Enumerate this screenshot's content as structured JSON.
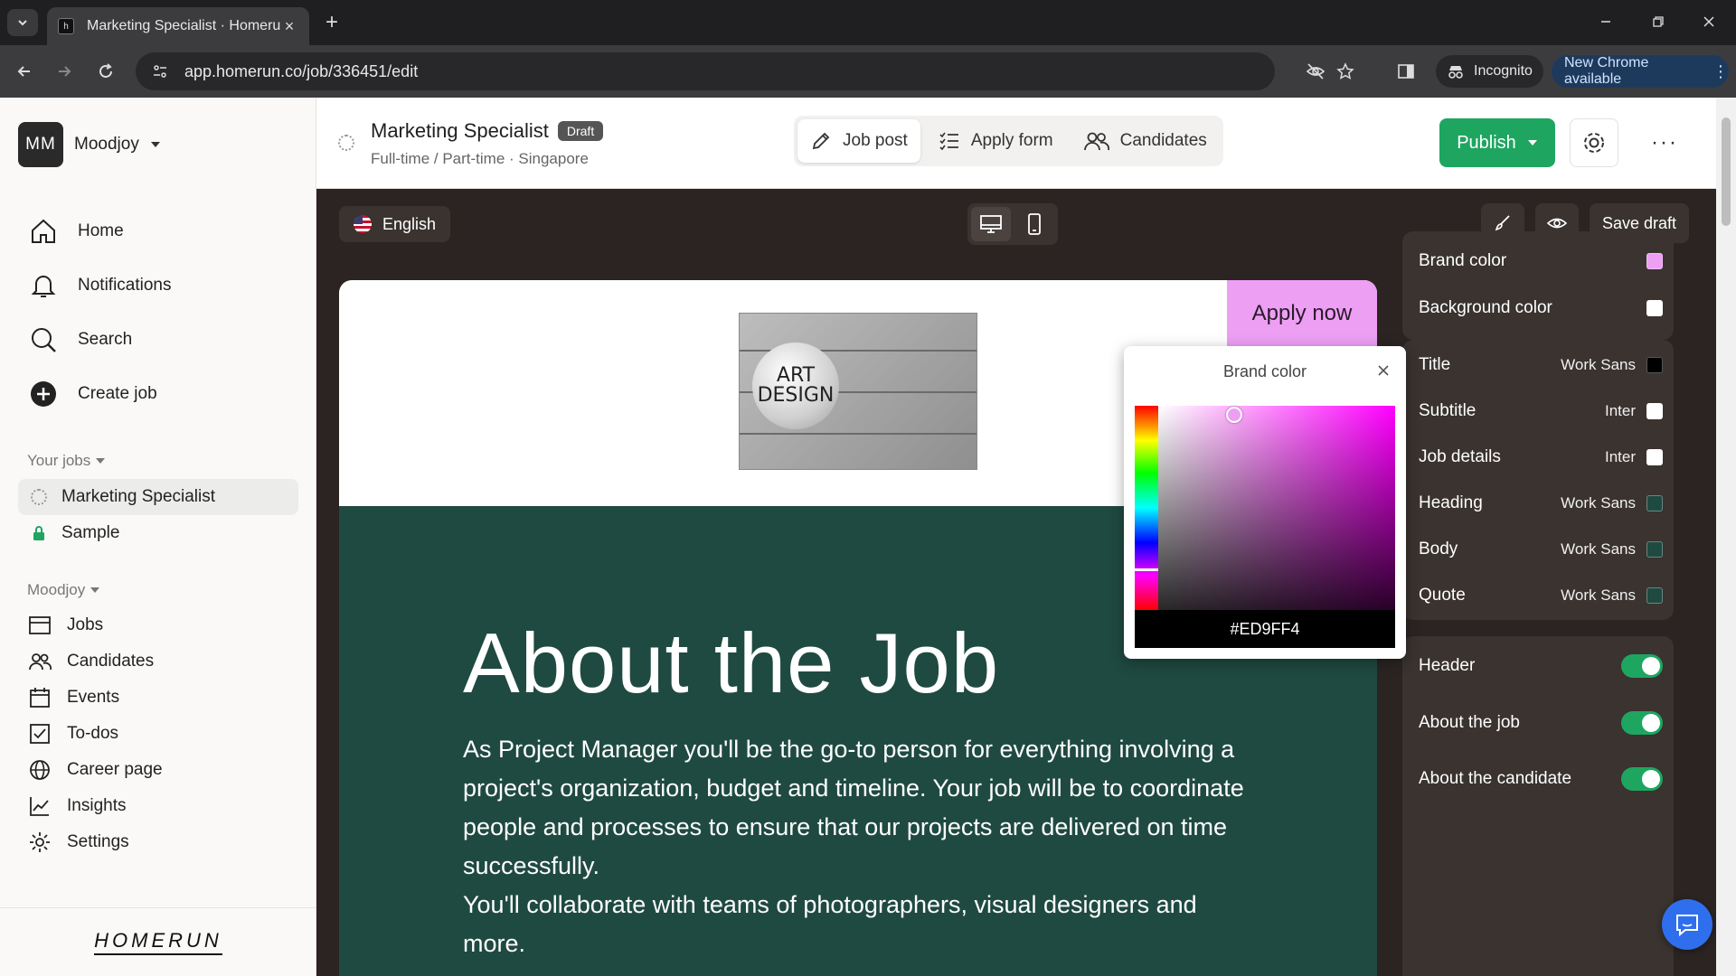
{
  "browser": {
    "tab_title": "Marketing Specialist · Homerun",
    "url": "app.homerun.co/job/336451/edit",
    "incognito_label": "Incognito",
    "new_chrome_label": "New Chrome available"
  },
  "sidebar": {
    "workspace_initials": "MM",
    "workspace_name": "Moodjoy",
    "nav": [
      {
        "label": "Home",
        "icon": "home-icon"
      },
      {
        "label": "Notifications",
        "icon": "bell-icon"
      },
      {
        "label": "Search",
        "icon": "search-icon"
      },
      {
        "label": "Create job",
        "icon": "plus-circle-icon"
      }
    ],
    "your_jobs_label": "Your jobs",
    "jobs": [
      {
        "label": "Marketing Specialist",
        "icon": "draft-ring-icon"
      },
      {
        "label": "Sample",
        "icon": "lock-icon"
      }
    ],
    "workspace_section_label": "Moodjoy",
    "workspace_nav": [
      {
        "label": "Jobs",
        "icon": "jobs-icon"
      },
      {
        "label": "Candidates",
        "icon": "people-icon"
      },
      {
        "label": "Events",
        "icon": "calendar-icon"
      },
      {
        "label": "To-dos",
        "icon": "checkbox-icon"
      },
      {
        "label": "Career page",
        "icon": "globe-icon"
      },
      {
        "label": "Insights",
        "icon": "chart-icon"
      },
      {
        "label": "Settings",
        "icon": "gear-icon"
      }
    ],
    "logo": "HOMERUN"
  },
  "header": {
    "job_title": "Marketing Specialist",
    "status_badge": "Draft",
    "meta": "Full-time / Part-time · Singapore",
    "tabs": [
      {
        "label": "Job post",
        "icon": "pencil-icon"
      },
      {
        "label": "Apply form",
        "icon": "list-icon"
      },
      {
        "label": "Candidates",
        "icon": "people-icon"
      }
    ],
    "publish_label": "Publish"
  },
  "toolbar": {
    "language": "English",
    "save_draft": "Save draft"
  },
  "preview": {
    "image_text": "ART DESIGN",
    "apply_now": "Apply now",
    "about_title": "About the Job",
    "about_text": "As Project Manager you'll be the go-to person for everything involving a project's organization, budget and timeline. Your job will be to coordinate people and processes to ensure that our projects are delivered on time successfully.",
    "about_text_2": "You'll collaborate with teams of photographers, visual designers and more."
  },
  "color_picker": {
    "title": "Brand color",
    "hex": "#ED9FF4"
  },
  "panel": {
    "colors": [
      {
        "label": "Brand color",
        "swatch": "#ED9FF4"
      },
      {
        "label": "Background color",
        "swatch": "#ffffff"
      }
    ],
    "typography": [
      {
        "label": "Title",
        "font": "Work Sans",
        "swatch": "#000000"
      },
      {
        "label": "Subtitle",
        "font": "Inter",
        "swatch": "#ffffff"
      },
      {
        "label": "Job details",
        "font": "Inter",
        "swatch": "#ffffff"
      },
      {
        "label": "Heading",
        "font": "Work Sans",
        "swatch": "#1f4a41"
      },
      {
        "label": "Body",
        "font": "Work Sans",
        "swatch": "#1f4a41"
      },
      {
        "label": "Quote",
        "font": "Work Sans",
        "swatch": "#1f4a41"
      }
    ],
    "sections": [
      {
        "label": "Header",
        "enabled": true
      },
      {
        "label": "About the job",
        "enabled": true
      },
      {
        "label": "About the candidate",
        "enabled": true
      }
    ]
  },
  "colors": {
    "brand": "#ED9FF4",
    "publish_green": "#1ea661",
    "preview_body": "#1f4a41"
  }
}
